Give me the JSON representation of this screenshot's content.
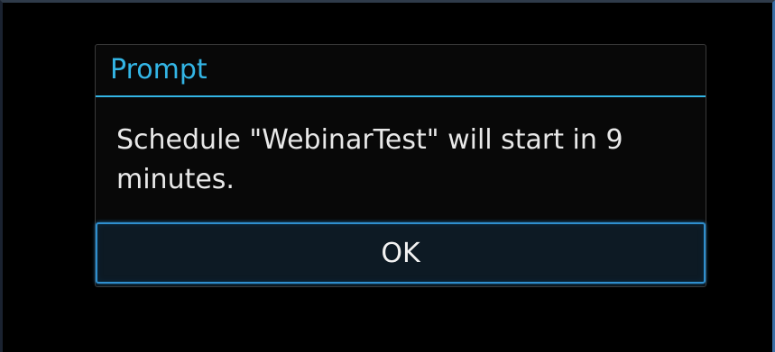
{
  "dialog": {
    "title": "Prompt",
    "message": "Schedule \"WebinarTest\" will start in 9 minutes.",
    "ok_label": "OK"
  },
  "colors": {
    "accent": "#33b5e5",
    "background": "#000000",
    "text": "#e8e8e8"
  }
}
